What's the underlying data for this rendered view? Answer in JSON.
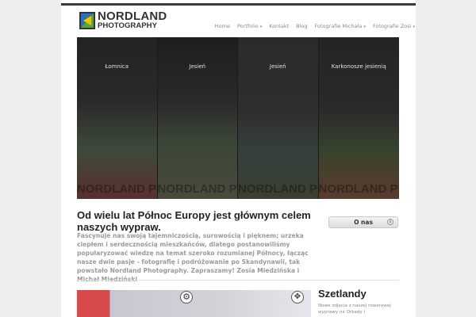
{
  "brand": {
    "line1": "NORDLAND",
    "line2": "PHOTOGRAPHY",
    "colors": {
      "green": "#5aa832",
      "blue": "#2a6fc0",
      "yellow": "#f2c300",
      "dark": "#333333"
    }
  },
  "nav": {
    "items": [
      {
        "label": "Home",
        "dropdown": false
      },
      {
        "label": "Portfolio",
        "dropdown": true
      },
      {
        "label": "Kontakt",
        "dropdown": false
      },
      {
        "label": "Blog",
        "dropdown": false
      },
      {
        "label": "Fotografie Michała",
        "dropdown": true
      },
      {
        "label": "Fotografie Zosi",
        "dropdown": true
      }
    ],
    "caret": "▾"
  },
  "gallery": {
    "panels": [
      {
        "caption": "Łomnica",
        "watermark": "NORDLAND PHOTOGRAPHY"
      },
      {
        "caption": "Jesień",
        "watermark": "NORDLAND PHOTOGRAPHY"
      },
      {
        "caption": "Jesień",
        "watermark": "NORDLAND PHOTOGRAPHY"
      },
      {
        "caption": "Karkonosze jesienią",
        "watermark": "NORDLAND PHOTOGRAPHY"
      }
    ]
  },
  "main": {
    "headline": "Od wielu lat Północ Europy jest głównym celem naszych wypraw.",
    "intro": "Fascynuje nas swoją tajemniczością, surowością i pięknem; urzeka ciepłem i serdecznością mieszkańców, dlatego postanowiliśmy popularyzować wiedzę na temat szeroko rozumianej Północy, łącząc nasze dwie pasje - fotografię i podróżowanie po Skandynawii, tak powstało Nordland Photography. Zapraszamy! Zosia Miedzińska i Michał Miedziński",
    "button_label": "O nas",
    "button_icon": "↓"
  },
  "feature": {
    "gear_icon": "⚙",
    "move_icon": "✥",
    "title": "Szetlandy",
    "text": "Nowe zdjęcia z naszej rowerowej wyprawy na Orkady i"
  }
}
